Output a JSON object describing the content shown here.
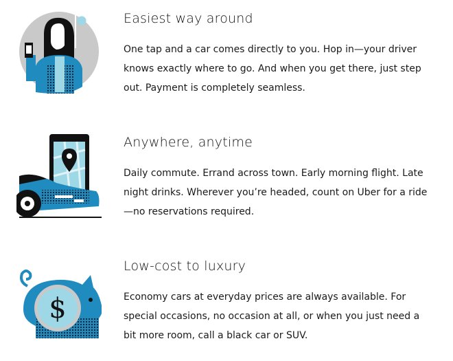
{
  "features": [
    {
      "title": "Easiest way around",
      "description": "One tap and a car comes directly to you. Hop in—your driver knows exactly where to go. And when you get there, just step out. Payment is completely seamless.",
      "icon": "rider-phone-icon"
    },
    {
      "title": "Anywhere, anytime",
      "description": "Daily commute. Errand across town. Early morning flight. Late night drinks. Wherever you’re headed, count on Uber for a ride —no reservations required.",
      "icon": "car-map-pin-icon"
    },
    {
      "title": "Low-cost to luxury",
      "description": "Economy cars at everyday prices are always available. For special occasions, no occasion at all, or when you just need a bit more room, call a black car or SUV.",
      "icon": "piggy-bank-dollar-icon"
    }
  ],
  "colors": {
    "accent_blue": "#1f8bbf",
    "light_blue": "#9ed8e6",
    "dark": "#111111",
    "grey": "#c9c9c9"
  }
}
